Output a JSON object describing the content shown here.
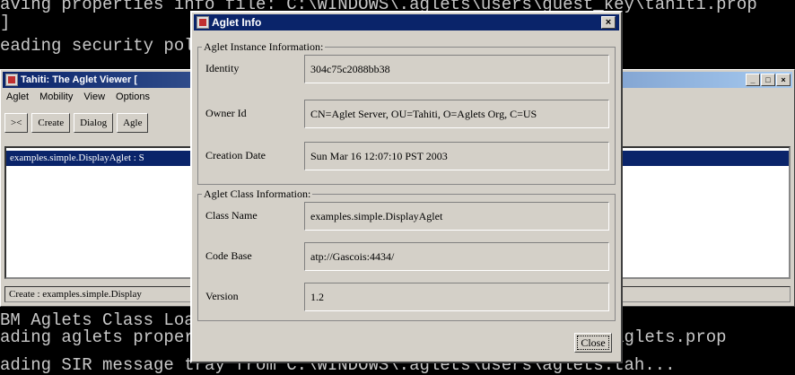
{
  "console": {
    "line1": "aving properties info file: C:\\WINDOWS\\.aglets\\users\\guest_key\\tahiti.prop",
    "line2": "]",
    "line3": "eading security policy file: C:\\WINDOWS\\.java.policy...",
    "line4": "BM Aglets Class Loader",
    "line5": "ading aglets properties: C:\\WINDOWS\\.aglets\\users\\guest_key\\aglets.prop",
    "line6": "ading SIR message tray from C:\\WINDOWS\\.aglets\\users\\aglets.tah..."
  },
  "tahiti": {
    "title": "Tahiti: The Aglet Viewer [",
    "menu": [
      "Aglet",
      "Mobility",
      "View",
      "Options"
    ],
    "toolbar": [
      "><",
      "Create",
      "Dialog",
      "Agle"
    ],
    "list_item": "examples.simple.DisplayAglet : S",
    "status": "Create : examples.simple.Display"
  },
  "dialog": {
    "title": "Aglet Info",
    "instance_group": "Aglet Instance Information:",
    "identity_label": "Identity",
    "identity_value": "304c75c2088bb38",
    "owner_label": "Owner Id",
    "owner_value": "CN=Aglet Server, OU=Tahiti, O=Aglets Org, C=US",
    "creation_label": "Creation Date",
    "creation_value": "Sun Mar 16 12:07:10 PST 2003",
    "class_group": "Aglet Class Information:",
    "classname_label": "Class Name",
    "classname_value": "examples.simple.DisplayAglet",
    "codebase_label": "Code Base",
    "codebase_value": "atp://Gascois:4434/",
    "version_label": "Version",
    "version_value": "1.2",
    "close_label": "Close"
  }
}
